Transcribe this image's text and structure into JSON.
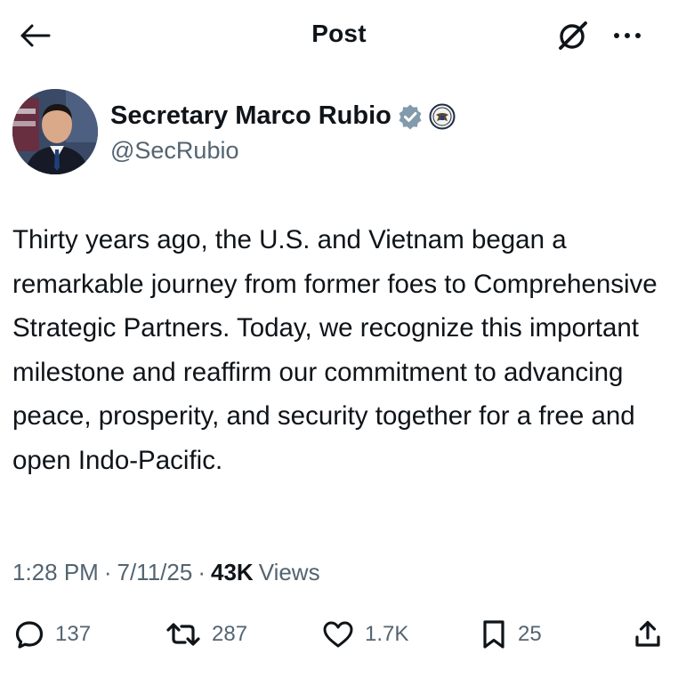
{
  "header": {
    "back_icon": "arrow-left-icon",
    "title": "Post",
    "grok_icon": "grok-icon",
    "more_icon": "more-horizontal-icon"
  },
  "author": {
    "display_name": "Secretary Marco Rubio",
    "handle": "@SecRubio",
    "badges": [
      "gray-verified-checkmark-icon",
      "us-state-department-seal-icon"
    ]
  },
  "tweet": {
    "text": "Thirty years ago, the U.S. and Vietnam began a remarkable journey from former foes to Comprehensive Strategic Partners. Today, we recognize this important milestone and reaffirm our commitment to advancing peace, prosperity, and security together for a free and open Indo-Pacific."
  },
  "meta": {
    "time": "1:28 PM",
    "date": "7/11/25",
    "separator": "·",
    "views_count": "43K",
    "views_label": "Views"
  },
  "actions": {
    "reply_count": "137",
    "repost_count": "287",
    "like_count": "1.7K",
    "bookmark_count": "25",
    "icons": [
      "reply-icon",
      "repost-icon",
      "like-icon",
      "bookmark-icon",
      "share-icon"
    ]
  },
  "colors": {
    "text_primary": "#0f1419",
    "text_secondary": "#536471",
    "verified_gray": "#829aab",
    "background": "#ffffff"
  }
}
